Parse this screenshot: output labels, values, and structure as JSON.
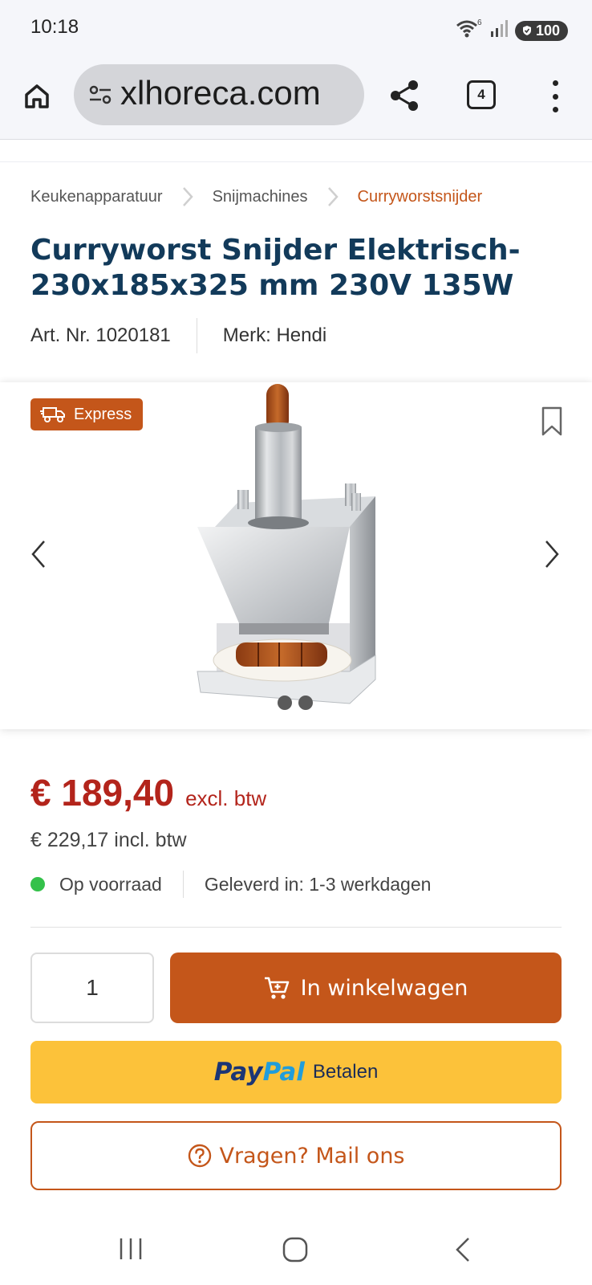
{
  "status_bar": {
    "time": "10:18",
    "wifi_badge": "6",
    "battery": "100"
  },
  "browser": {
    "url": "xlhoreca.com",
    "tab_count": "4",
    "icons": [
      "home-icon",
      "site-settings-icon",
      "share-icon",
      "tabs-icon",
      "more-vert-icon"
    ]
  },
  "breadcrumb": {
    "items": [
      "Keukenapparatuur",
      "Snijmachines",
      "Curryworstsnijder"
    ]
  },
  "product": {
    "title": "Curryworst Snijder Elektrisch-230x185x325 mm 230V 135W",
    "art_nr": "Art. Nr. 1020181",
    "brand": "Merk: Hendi",
    "badge": "Express",
    "image_count_visible": 2
  },
  "pricing": {
    "price_excl": "€ 189,40",
    "excl_label": "excl. btw",
    "price_incl": "€ 229,17 incl. btw",
    "stock_status": "Op voorraad",
    "delivery": "Geleverd in: 1-3 werkdagen"
  },
  "actions": {
    "quantity": "1",
    "cart_label": "In winkelwagen",
    "paypal_pay": "Pay",
    "paypal_pal": "Pal",
    "paypal_label": "Betalen",
    "mail_label": "Vragen? Mail ons"
  },
  "colors": {
    "accent": "#c4561a",
    "price": "#b3241b",
    "title": "#123a5a",
    "paypal": "#fcc23a",
    "in_stock": "#34c14a"
  }
}
